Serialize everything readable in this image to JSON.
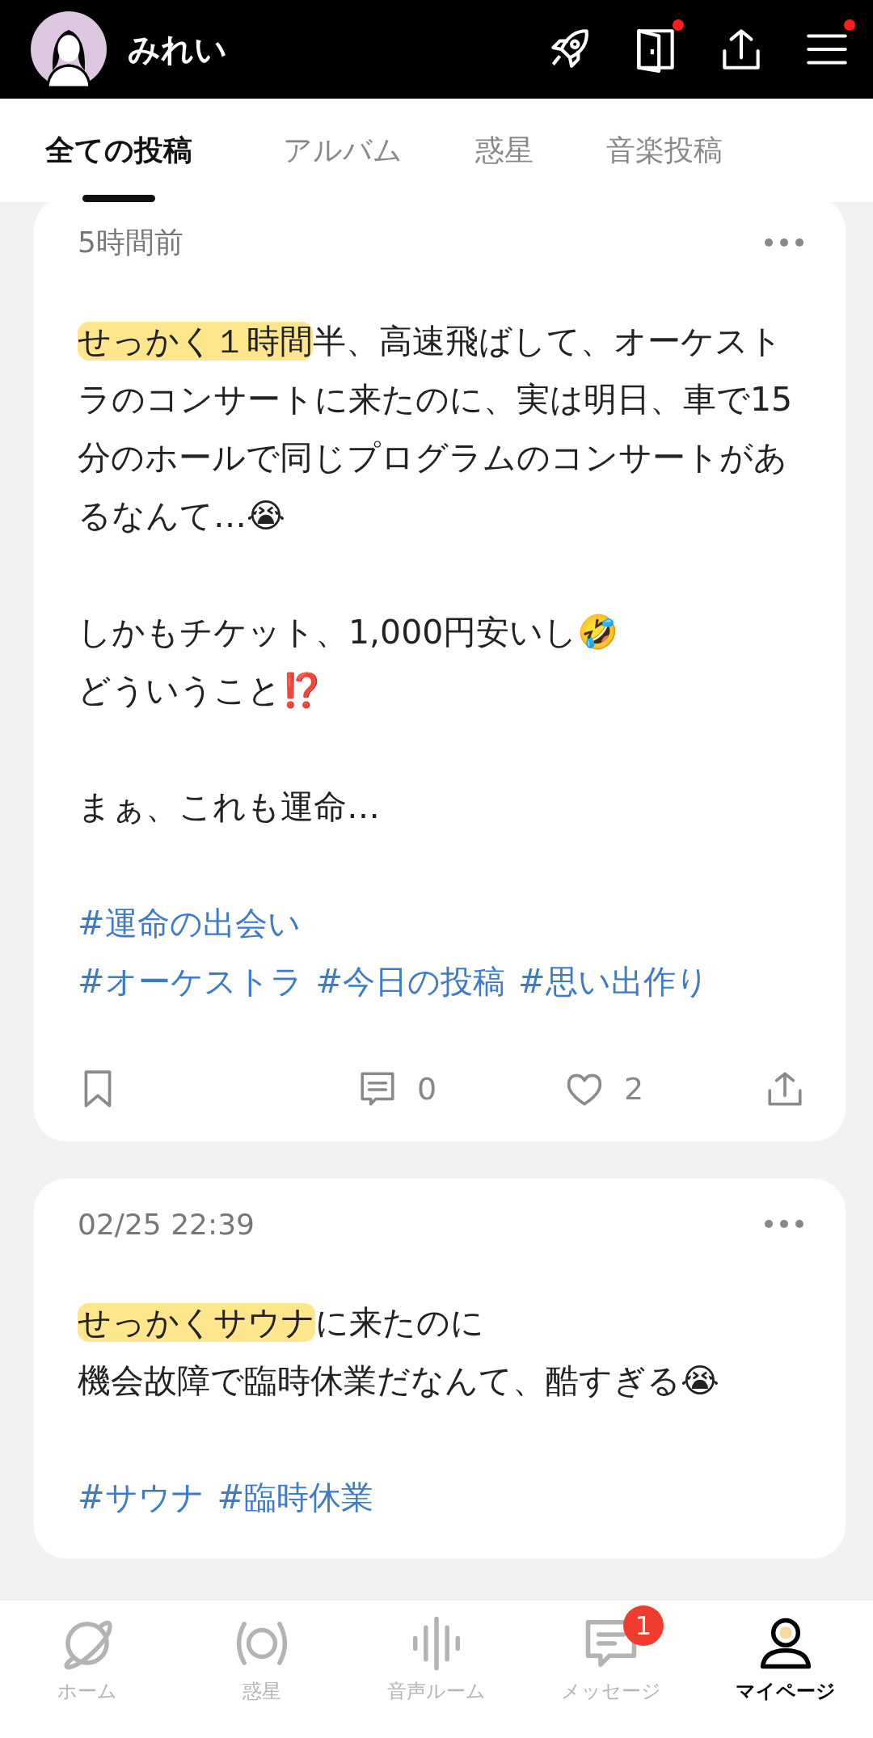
{
  "header": {
    "user_name": "みれい",
    "icons": [
      {
        "kind": "rocket",
        "dot": false
      },
      {
        "kind": "door",
        "dot": true
      },
      {
        "kind": "share",
        "dot": false
      },
      {
        "kind": "menu",
        "dot": true
      }
    ]
  },
  "tabs": [
    {
      "label": "全ての投稿",
      "selected": true
    },
    {
      "label": "アルバム",
      "selected": false
    },
    {
      "label": "惑星",
      "selected": false
    },
    {
      "label": "音楽投稿",
      "selected": false
    }
  ],
  "posts": [
    {
      "time": "5時間前",
      "blocks": [
        [
          [
            {
              "text": "せっかく１時間",
              "highlighted": true
            },
            {
              "text": "半、高速飛ばして、オーケストラのコンサートに来たのに、実は明日、車で15分のホールで同じプログラムのコンサートがあるなんて…😭",
              "highlighted": false
            }
          ]
        ],
        [
          [
            {
              "text": "しかもチケット、1,000円安いし🤣",
              "highlighted": false
            }
          ],
          [
            {
              "text": "どういうこと⁉️",
              "highlighted": false
            }
          ]
        ],
        [
          [
            {
              "text": "まぁ、これも運命…",
              "highlighted": false
            }
          ]
        ]
      ],
      "hashtag_lines": [
        [
          "#運命の出会い"
        ],
        [
          "#オーケストラ",
          "#今日の投稿",
          "#思い出作り"
        ]
      ],
      "comments": "0",
      "likes": "2"
    },
    {
      "time": "02/25 22:39",
      "blocks": [
        [
          [
            {
              "text": "せっかくサウナ",
              "highlighted": true
            },
            {
              "text": "に来たのに",
              "highlighted": false
            }
          ],
          [
            {
              "text": "機会故障で臨時休業だなんて、酷すぎる😭",
              "highlighted": false
            }
          ]
        ]
      ],
      "hashtag_lines": [
        [
          "#サウナ",
          "#臨時休業"
        ]
      ]
    }
  ],
  "bottom_nav": [
    {
      "kind": "planet",
      "label": "ホーム",
      "selected": false
    },
    {
      "kind": "ring",
      "label": "惑星",
      "selected": false
    },
    {
      "kind": "voice",
      "label": "音声ルーム",
      "selected": false
    },
    {
      "kind": "message",
      "label": "メッセージ",
      "selected": false,
      "badge": "1"
    },
    {
      "kind": "person",
      "label": "マイページ",
      "selected": true
    }
  ]
}
